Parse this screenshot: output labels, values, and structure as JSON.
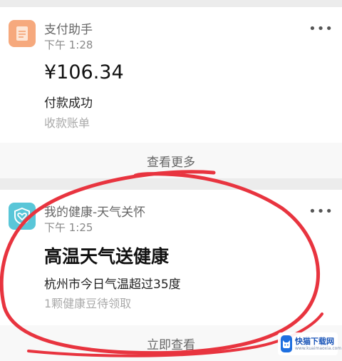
{
  "payment_card": {
    "app_name": "支付助手",
    "time": "下午 1:28",
    "more": "•••",
    "amount": "¥106.34",
    "status": "付款成功",
    "subtitle": "收款账单",
    "view_more": "查看更多",
    "icon": "receipt-icon",
    "icon_color": "#f6a97d"
  },
  "health_card": {
    "app_name": "我的健康-天气关怀",
    "time": "下午 1:25",
    "more": "•••",
    "headline": "高温天气送健康",
    "detail": "杭州市今日气温超过35度",
    "subtitle": "1颗健康豆待领取",
    "action": "立即查看",
    "icon": "heart-shield-icon",
    "icon_color": "#59c6d8"
  },
  "annotation": {
    "color": "#e8343f"
  },
  "watermark": {
    "main": "快猫下载网",
    "sub": "www.kuaimaoxia.com",
    "logo_color": "#1e6fe0"
  }
}
